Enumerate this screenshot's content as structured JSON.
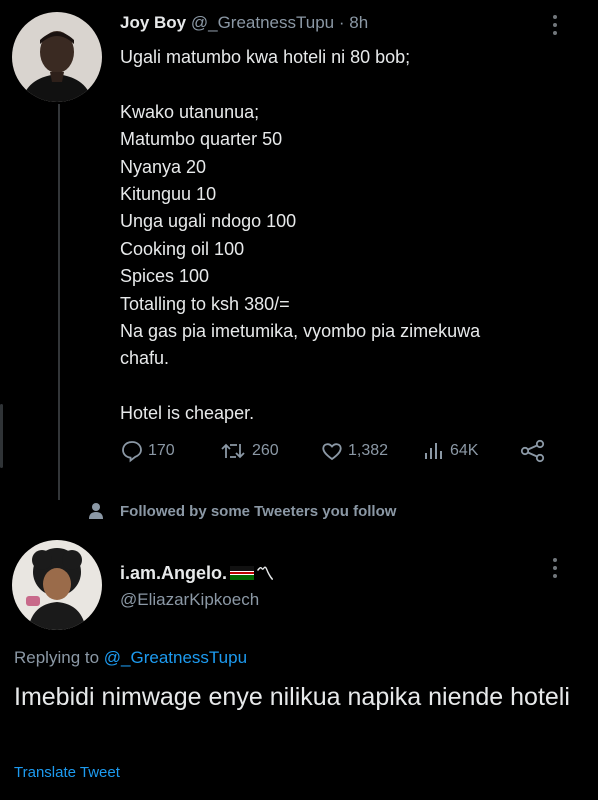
{
  "tweet": {
    "author_name": "Joy Boy",
    "author_handle": "@_GreatnessTupu",
    "separator": "·",
    "time": "8h",
    "lines": [
      "Ugali matumbo kwa hoteli ni 80 bob;",
      "",
      "Kwako utanunua;",
      "Matumbo quarter 50",
      "Nyanya 20",
      "Kitunguu 10",
      "Unga ugali ndogo 100",
      "Cooking oil 100",
      "Spices 100",
      "Totalling to ksh 380/=",
      "Na gas pia imetumika, vyombo pia zimekuwa",
      "chafu.",
      "",
      "Hotel is cheaper."
    ],
    "stats": {
      "replies": "170",
      "retweets": "260",
      "likes": "1,382",
      "views": "64K"
    }
  },
  "social_context": "Followed by some Tweeters you follow",
  "reply": {
    "author_name": "i.am.Angelo.",
    "name_suffix": "〽",
    "author_handle": "@EliazarKipkoech",
    "replying_prefix": "Replying to ",
    "replying_to": "@_GreatnessTupu",
    "text": "Imebidi nimwage enye nilikua napika niende hoteli",
    "translate_label": "Translate Tweet"
  },
  "colors": {
    "background": "#000000",
    "text": "#e7e9ea",
    "muted": "#8b98a5",
    "link": "#1d9bf0"
  },
  "icons": [
    "reply-icon",
    "retweet-icon",
    "like-icon",
    "views-icon",
    "share-icon",
    "person-icon",
    "more-icon",
    "kenya-flag-icon"
  ]
}
